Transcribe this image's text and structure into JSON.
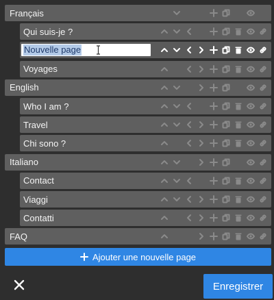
{
  "tree": {
    "rows": [
      {
        "id": "francais",
        "label": "Français",
        "level": 0,
        "tools": [
          "up-off",
          "down",
          "left-off",
          "right-off",
          "add",
          "duplicate",
          "delete-off",
          "visibility",
          "link-off"
        ]
      },
      {
        "id": "qui-suis-je",
        "label": "Qui suis-je ?",
        "level": 1,
        "tools": [
          "up",
          "down",
          "left",
          "right-off",
          "add",
          "duplicate",
          "delete",
          "visibility",
          "link"
        ]
      },
      {
        "id": "nouvelle-page",
        "label": "Nouvelle page",
        "level": 1,
        "editing": true,
        "tools": [
          "up",
          "down",
          "left",
          "right",
          "add",
          "duplicate",
          "delete",
          "visibility",
          "link"
        ]
      },
      {
        "id": "voyages",
        "label": "Voyages",
        "level": 1,
        "tools": [
          "up",
          "down-off",
          "left",
          "right",
          "add",
          "duplicate",
          "delete",
          "visibility",
          "link"
        ]
      },
      {
        "id": "english",
        "label": "English",
        "level": 0,
        "tools": [
          "up",
          "down",
          "left-off",
          "right",
          "add",
          "duplicate",
          "delete-off",
          "visibility",
          "link"
        ]
      },
      {
        "id": "who-i-am",
        "label": "Who I am ?",
        "level": 1,
        "tools": [
          "up",
          "down",
          "left",
          "right-off",
          "add",
          "duplicate",
          "delete",
          "visibility",
          "link"
        ]
      },
      {
        "id": "travel",
        "label": "Travel",
        "level": 1,
        "tools": [
          "up",
          "down",
          "left",
          "right",
          "add",
          "duplicate",
          "delete",
          "visibility",
          "link"
        ]
      },
      {
        "id": "chi-sono",
        "label": "Chi sono ?",
        "level": 1,
        "tools": [
          "up",
          "down-off",
          "left",
          "right",
          "add",
          "duplicate",
          "delete",
          "visibility",
          "link"
        ]
      },
      {
        "id": "italiano",
        "label": "Italiano",
        "level": 0,
        "tools": [
          "up",
          "down",
          "left-off",
          "right",
          "add",
          "duplicate",
          "delete-off",
          "visibility",
          "link"
        ]
      },
      {
        "id": "contact",
        "label": "Contact",
        "level": 1,
        "tools": [
          "up",
          "down",
          "left",
          "right-off",
          "add",
          "duplicate",
          "delete",
          "visibility",
          "link"
        ]
      },
      {
        "id": "viaggi",
        "label": "Viaggi",
        "level": 1,
        "tools": [
          "up",
          "down",
          "left",
          "right",
          "add",
          "duplicate",
          "delete",
          "visibility",
          "link"
        ]
      },
      {
        "id": "contatti",
        "label": "Contatti",
        "level": 1,
        "tools": [
          "up",
          "down-off",
          "left",
          "right",
          "add",
          "duplicate",
          "delete",
          "visibility",
          "link"
        ]
      },
      {
        "id": "faq",
        "label": "FAQ",
        "level": 0,
        "tools": [
          "up",
          "down-off",
          "left-off",
          "right",
          "add",
          "duplicate",
          "delete",
          "visibility",
          "link"
        ]
      }
    ]
  },
  "add_page_label": "Ajouter une nouvelle page",
  "save_label": "Enregistrer",
  "colors": {
    "accent": "#2f86e4",
    "row_bg": "#5f5f5f",
    "background": "#2e2e2e",
    "icon_muted": "#8a8a8a"
  }
}
